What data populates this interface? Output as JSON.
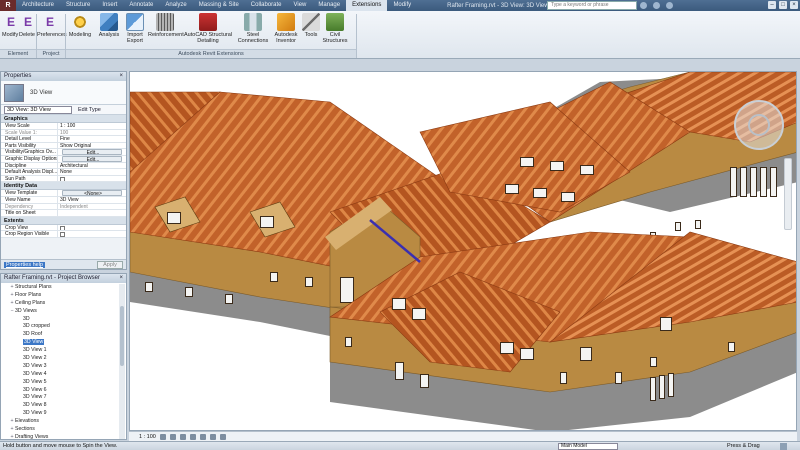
{
  "titlebar": {
    "app_badge": "R",
    "tabs": [
      "Architecture",
      "Structure",
      "Insert",
      "Annotate",
      "Analyze",
      "Massing & Site",
      "Collaborate",
      "View",
      "Manage",
      "Extensions",
      "Modify"
    ],
    "active_tab_index": 9,
    "title": "Rafter Framing.rvt - 3D View: 3D View 1",
    "search_placeholder": "Type a keyword or phrase"
  },
  "ribbon": {
    "buttons": [
      {
        "label": "Modify",
        "icon": "ee"
      },
      {
        "label": "Delete",
        "icon": "ee"
      },
      {
        "label": "Preferences",
        "icon": "ee"
      },
      {
        "label": "Modeling",
        "icon": "ico-gear"
      },
      {
        "label": "Analysis",
        "icon": "ico-cube"
      },
      {
        "label": "Import Export",
        "icon": "ico-export"
      },
      {
        "label": "Reinforcement",
        "icon": "ico-rebar"
      },
      {
        "label": "AutoCAD Structural Detailing",
        "icon": "ico-autocad"
      },
      {
        "label": "Steel Connections",
        "icon": "ico-steel"
      },
      {
        "label": "Autodesk Inventor",
        "icon": "ico-inv"
      },
      {
        "label": "Tools",
        "icon": "ico-tools"
      },
      {
        "label": "Civil Structures",
        "icon": "ico-civil"
      }
    ],
    "panels": [
      {
        "label": "Element"
      },
      {
        "label": "Project"
      },
      {
        "label": "Autodesk Revit Extensions"
      }
    ]
  },
  "properties": {
    "title": "Properties",
    "type_name": "3D View",
    "view_selector": "3D View: 3D View",
    "edit_type": "Edit Type",
    "groups": [
      {
        "name": "Graphics",
        "rows": [
          {
            "k": "View Scale",
            "v": "1 : 100"
          },
          {
            "k": "Scale Value 1:",
            "v": "100",
            "dim": true
          },
          {
            "k": "Detail Level",
            "v": "Fine"
          },
          {
            "k": "Parts Visibility",
            "v": "Show Original"
          },
          {
            "k": "Visibility/Graphics Ov...",
            "v": "Edit...",
            "button": true
          },
          {
            "k": "Graphic Display Options",
            "v": "Edit...",
            "button": true
          },
          {
            "k": "Discipline",
            "v": "Architectural"
          },
          {
            "k": "Default Analysis Displ...",
            "v": "None"
          },
          {
            "k": "Sun Path",
            "v": "",
            "check": true
          }
        ]
      },
      {
        "name": "Identity Data",
        "rows": [
          {
            "k": "View Template",
            "v": "<None>",
            "button": true
          },
          {
            "k": "View Name",
            "v": "3D View"
          },
          {
            "k": "Dependency",
            "v": "Independent",
            "dim": true
          },
          {
            "k": "Title on Sheet",
            "v": ""
          }
        ]
      },
      {
        "name": "Extents",
        "rows": [
          {
            "k": "Crop View",
            "v": "",
            "check": true
          },
          {
            "k": "Crop Region Visible",
            "v": "",
            "check": true
          }
        ]
      }
    ],
    "help_link": "Properties help",
    "apply": "Apply"
  },
  "browser": {
    "title": "Rafter Framing.rvt - Project Browser",
    "items": [
      {
        "label": "Structural Plans",
        "indent": 1,
        "tw": "+"
      },
      {
        "label": "Floor Plans",
        "indent": 1,
        "tw": "+"
      },
      {
        "label": "Ceiling Plans",
        "indent": 1,
        "tw": "+"
      },
      {
        "label": "3D Views",
        "indent": 1,
        "tw": "−"
      },
      {
        "label": "3D",
        "indent": 2,
        "tw": ""
      },
      {
        "label": "3D cropped",
        "indent": 2,
        "tw": ""
      },
      {
        "label": "3D Roof",
        "indent": 2,
        "tw": ""
      },
      {
        "label": "3D View",
        "indent": 2,
        "tw": "",
        "selected": true
      },
      {
        "label": "3D View 1",
        "indent": 2,
        "tw": ""
      },
      {
        "label": "3D View 2",
        "indent": 2,
        "tw": ""
      },
      {
        "label": "3D View 3",
        "indent": 2,
        "tw": ""
      },
      {
        "label": "3D View 4",
        "indent": 2,
        "tw": ""
      },
      {
        "label": "3D View 5",
        "indent": 2,
        "tw": ""
      },
      {
        "label": "3D View 6",
        "indent": 2,
        "tw": ""
      },
      {
        "label": "3D View 7",
        "indent": 2,
        "tw": ""
      },
      {
        "label": "3D View 8",
        "indent": 2,
        "tw": ""
      },
      {
        "label": "3D View 9",
        "indent": 2,
        "tw": ""
      },
      {
        "label": "Elevations",
        "indent": 1,
        "tw": "+"
      },
      {
        "label": "Sections",
        "indent": 1,
        "tw": "+"
      },
      {
        "label": "Drafting Views",
        "indent": 1,
        "tw": "+"
      }
    ]
  },
  "viewctrl": {
    "scale": "1 : 100"
  },
  "status": {
    "hint": "Hold button and move mouse to Spin the View.",
    "model": "Main Model",
    "press_drag": "Press & Drag"
  },
  "colors": {
    "roof": "#c2622a",
    "rafter": "#e08a4a",
    "wall": "#b98a42",
    "plinth": "#8c8c8c",
    "window": "#ffffff",
    "accent": "#3c77c6"
  }
}
